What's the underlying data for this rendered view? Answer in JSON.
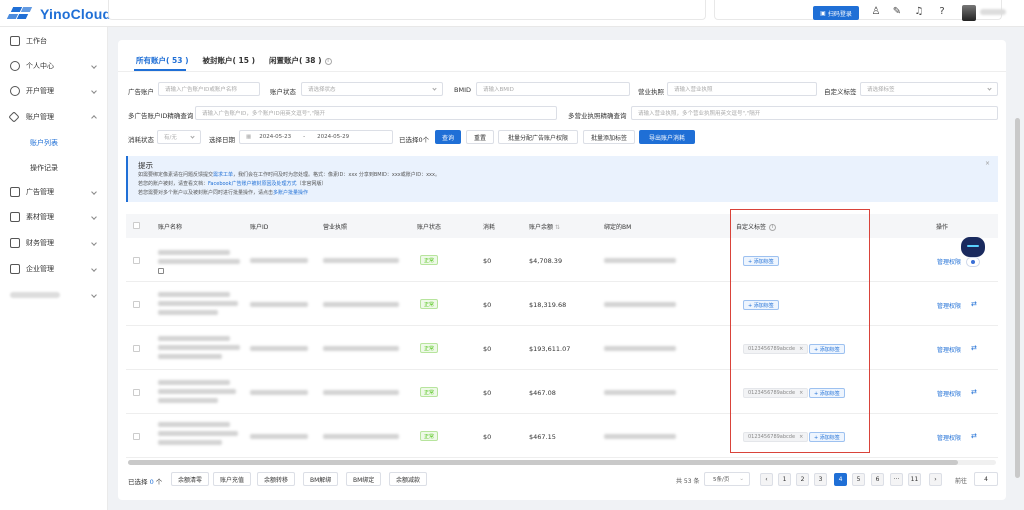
{
  "app": {
    "logo_text": "YinoCloud"
  },
  "header": {
    "scan_button_label": "扫码登录"
  },
  "sidebar": {
    "items": [
      {
        "label": "工作台"
      },
      {
        "label": "个人中心"
      },
      {
        "label": "开户管理"
      },
      {
        "label": "账户管理"
      },
      {
        "label": "广告管理"
      },
      {
        "label": "素材管理"
      },
      {
        "label": "财务管理"
      },
      {
        "label": "企业管理"
      }
    ],
    "sub_items": [
      {
        "label": "账户列表"
      },
      {
        "label": "操作记录"
      }
    ]
  },
  "tabs": [
    {
      "label": "所有账户( 53 )"
    },
    {
      "label": "被封账户( 15 )"
    },
    {
      "label": "闲置账户( 38 )"
    }
  ],
  "filters": {
    "ad_account_label": "广告账户",
    "ad_account_placeholder": "请输入广告账户ID或账户名称",
    "account_status_label": "账户状态",
    "account_status_placeholder": "请选择状态",
    "bmid_label": "BMID",
    "bmid_placeholder": "请输入BMID",
    "license_label": "营业执照",
    "license_placeholder": "请输入营业执照",
    "custom_tag_label": "自定义标签",
    "custom_tag_placeholder": "请选择标签",
    "multi_id_label": "多广告账户ID精确查询",
    "multi_id_placeholder": "请输入广告账户ID，多个账户ID用英文逗号\",\"隔开",
    "multi_license_label": "多营业执照精确查询",
    "multi_license_placeholder": "请输入营业执照，多个营业执照用英文逗号\",\"隔开",
    "consume_status_label": "消耗状态",
    "consume_status_value": "有/无",
    "date_label": "选择日期",
    "date_start": "2024-05-23",
    "date_sep": "-",
    "date_end": "2024-05-29",
    "selected_label": "已选择0个",
    "search_button": "查询",
    "reset_button": "重置",
    "batch_assign_button": "批量分配广告账户权限",
    "batch_tag_button": "批量添加标签",
    "export_button": "导出账户消耗"
  },
  "tip": {
    "title": "提示",
    "line1_a": "如需要绑定像素请在问题反馈提交",
    "line1_link": "需求工单",
    "line1_b": "，我们会在工作时间及时为您处理。格式：像素ID：xxx  分享到BMID：xxx或账户ID：xxx。",
    "line2_a": "若您的账户被封，请查看文档：",
    "line2_link": "Facebook广告账户被封原因及处理方式",
    "line2_b": "（非官网版）",
    "line3_a": "若您需要对多个账户以及被封账户同时进行批量操作，请点击",
    "line3_link": "多账户批量操作"
  },
  "table": {
    "headers": [
      "账户名称",
      "账户ID",
      "营业执照",
      "账户状态",
      "消耗",
      "账户余额",
      "绑定的BM",
      "自定义标签",
      "操作"
    ],
    "rows": [
      {
        "status": "正常",
        "consume": "$0",
        "balance": "$4,708.39",
        "tag": "",
        "add_tag": "+ 添加标签",
        "op": "管理权限"
      },
      {
        "status": "正常",
        "consume": "$0",
        "balance": "$18,319.68",
        "tag": "",
        "add_tag": "+ 添加标签",
        "op": "管理权限"
      },
      {
        "status": "正常",
        "consume": "$0",
        "balance": "$193,611.07",
        "tag": "0123456789abcde",
        "add_tag": "+ 添加标签",
        "op": "管理权限"
      },
      {
        "status": "正常",
        "consume": "$0",
        "balance": "$467.08",
        "tag": "0123456789abcde",
        "add_tag": "+ 添加标签",
        "op": "管理权限"
      },
      {
        "status": "正常",
        "consume": "$0",
        "balance": "$467.15",
        "tag": "0123456789abcde",
        "add_tag": "+ 添加标签",
        "op": "管理权限"
      }
    ]
  },
  "footer": {
    "selected_prefix": "已选择",
    "selected_count": "0",
    "selected_suffix": "个",
    "buttons": [
      "余额清零",
      "账户充值",
      "余额转移",
      "BM解绑",
      "BM绑定",
      "余额减款"
    ],
    "total": "共 53 条",
    "page_size": "5条/页",
    "pages": [
      "1",
      "2",
      "3",
      "4",
      "5",
      "6",
      "···",
      "11"
    ],
    "current_page": "4",
    "goto_label": "前往",
    "goto_value": "4"
  },
  "colors": {
    "primary": "#1f6fd6",
    "highlight_border": "#d9433a",
    "status_green": "#52c41a"
  }
}
